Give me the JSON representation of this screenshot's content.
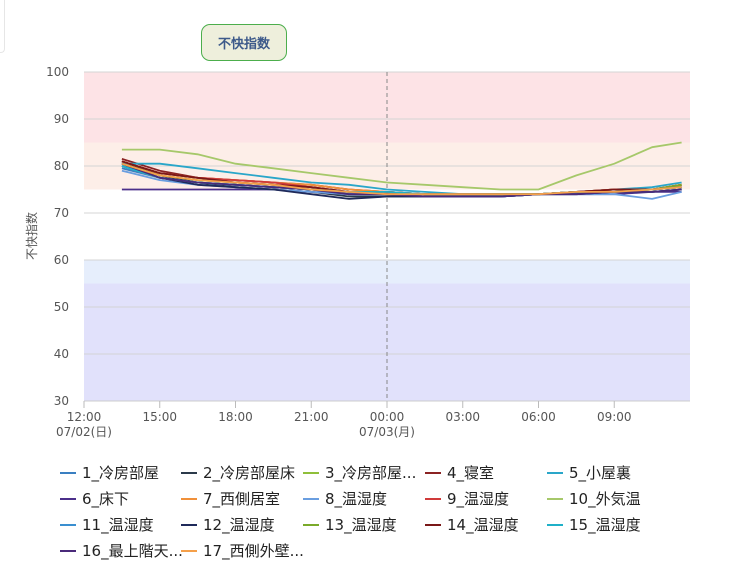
{
  "chart_data": {
    "type": "line",
    "title": "不快指数",
    "ylabel": "不快指数",
    "ylim": [
      30,
      100
    ],
    "yticks": [
      30,
      40,
      50,
      60,
      70,
      80,
      90,
      100
    ],
    "xlim": [
      "2023-07-02 12:00",
      "2023-07-03 12:00"
    ],
    "xticks": [
      {
        "t": "2023-07-02 12:00",
        "l1": "12:00",
        "l2": "07/02(日)"
      },
      {
        "t": "2023-07-02 15:00",
        "l1": "15:00",
        "l2": ""
      },
      {
        "t": "2023-07-02 18:00",
        "l1": "18:00",
        "l2": ""
      },
      {
        "t": "2023-07-02 21:00",
        "l1": "21:00",
        "l2": ""
      },
      {
        "t": "2023-07-03 00:00",
        "l1": "00:00",
        "l2": "07/03(月)"
      },
      {
        "t": "2023-07-03 03:00",
        "l1": "03:00",
        "l2": ""
      },
      {
        "t": "2023-07-03 06:00",
        "l1": "06:00",
        "l2": ""
      },
      {
        "t": "2023-07-03 09:00",
        "l1": "09:00",
        "l2": ""
      }
    ],
    "bands": [
      {
        "from": 85,
        "to": 100,
        "color": "#fde3e6"
      },
      {
        "from": 75,
        "to": 85,
        "color": "#fdeee8"
      },
      {
        "from": 55,
        "to": 60,
        "color": "#e6eefc"
      },
      {
        "from": 30,
        "to": 55,
        "color": "#e1e1fb"
      }
    ],
    "day_divider": "2023-07-03 00:00",
    "x": [
      "2023-07-02 13:30",
      "2023-07-02 15:00",
      "2023-07-02 16:30",
      "2023-07-02 18:00",
      "2023-07-02 19:30",
      "2023-07-02 21:00",
      "2023-07-02 22:30",
      "2023-07-03 00:00",
      "2023-07-03 01:30",
      "2023-07-03 03:00",
      "2023-07-03 04:30",
      "2023-07-03 06:00",
      "2023-07-03 07:30",
      "2023-07-03 09:00",
      "2023-07-03 10:30",
      "2023-07-03 11:40"
    ],
    "series": [
      {
        "name": "1_冷房部屋",
        "color": "#3a7fc1",
        "values": [
          79.5,
          77.5,
          76.5,
          76,
          75.5,
          75,
          74,
          74,
          73.5,
          73.5,
          73.5,
          74,
          74.5,
          74.5,
          74.5,
          75
        ]
      },
      {
        "name": "2_冷房部屋床",
        "color": "#2b3a4a",
        "values": [
          81,
          78,
          76.5,
          75.5,
          75,
          74.5,
          73.5,
          73.5,
          73.5,
          73.5,
          73.5,
          74,
          74.5,
          74.5,
          75,
          75.5
        ]
      },
      {
        "name": "3_冷房部屋...",
        "color": "#8fbf3a",
        "values": [
          80,
          77.5,
          76.5,
          76,
          75.5,
          75,
          74.5,
          74.5,
          74,
          74,
          74,
          74,
          74.5,
          75,
          75,
          76
        ]
      },
      {
        "name": "4_寝室",
        "color": "#8b2323",
        "values": [
          81.5,
          79,
          77.5,
          77,
          76.5,
          76,
          75,
          74.5,
          74,
          74,
          74,
          74,
          74.5,
          75,
          75,
          76
        ]
      },
      {
        "name": "5_小屋裏",
        "color": "#2aa6c9",
        "values": [
          80.5,
          80.5,
          79.5,
          78.5,
          77.5,
          76.5,
          76,
          75,
          74.5,
          74,
          74,
          74,
          74.5,
          75,
          75.5,
          76.5
        ]
      },
      {
        "name": "6_床下",
        "color": "#4b2f8a",
        "values": [
          75,
          75,
          75,
          75,
          75,
          74.5,
          74,
          74,
          73.5,
          73.5,
          73.5,
          74,
          74,
          74,
          74.5,
          74.5
        ]
      },
      {
        "name": "7_西側居室",
        "color": "#f0903a",
        "values": [
          81,
          78.5,
          77.5,
          77,
          76.5,
          76,
          75,
          74.5,
          74,
          74,
          74,
          74,
          74.5,
          75,
          75,
          76
        ]
      },
      {
        "name": "8_温湿度",
        "color": "#6a9ee0",
        "values": [
          79,
          77,
          76,
          75.5,
          75,
          74.5,
          74,
          74,
          73.5,
          73.5,
          73.5,
          74,
          74,
          74,
          73,
          74.5
        ]
      },
      {
        "name": "9_温湿度",
        "color": "#d03a3a",
        "values": [
          81,
          78.5,
          77.5,
          77,
          76.5,
          75.5,
          74.5,
          74.5,
          74,
          74,
          74,
          74,
          74.5,
          75,
          75,
          76
        ]
      },
      {
        "name": "10_外気温",
        "color": "#a6c86a",
        "values": [
          83.5,
          83.5,
          82.5,
          80.5,
          79.5,
          78.5,
          77.5,
          76.5,
          76,
          75.5,
          75,
          75,
          78,
          80.5,
          84,
          85
        ]
      },
      {
        "name": "11_温湿度",
        "color": "#3a8fd0",
        "values": [
          80,
          77.5,
          76.5,
          76,
          75.5,
          75,
          74,
          74,
          73.5,
          73.5,
          73.5,
          74,
          74.5,
          74.5,
          74.5,
          75
        ]
      },
      {
        "name": "12_温湿度",
        "color": "#1f2a5a",
        "values": [
          80.5,
          77.5,
          76,
          75.5,
          75,
          74,
          73,
          73.5,
          73.5,
          73.5,
          73.5,
          74,
          74,
          74.5,
          74.5,
          75
        ]
      },
      {
        "name": "13_温湿度",
        "color": "#7aaa2a",
        "values": [
          80.5,
          78,
          77,
          76.5,
          76,
          75,
          74.5,
          74,
          74,
          74,
          74,
          74,
          74.5,
          74.5,
          75,
          76
        ]
      },
      {
        "name": "14_温湿度",
        "color": "#7a1818",
        "values": [
          81,
          78.5,
          77.5,
          76.5,
          76,
          75.5,
          74.5,
          74,
          74,
          74,
          74,
          74,
          74.5,
          75,
          75,
          75.5
        ]
      },
      {
        "name": "15_温湿度",
        "color": "#1fb0c8",
        "values": [
          80,
          77.5,
          76.5,
          76,
          75.5,
          75,
          74.5,
          74.5,
          74,
          74,
          74,
          74,
          74.5,
          74.5,
          75,
          75.5
        ]
      },
      {
        "name": "16_最上階天...",
        "color": "#4a2a7a",
        "values": [
          80.5,
          77.5,
          76.5,
          76,
          75.5,
          75,
          74,
          74,
          73.5,
          73.5,
          73.5,
          74,
          74,
          74.5,
          74.5,
          75
        ]
      },
      {
        "name": "17_西側外壁...",
        "color": "#f5a04a",
        "values": [
          80.5,
          78,
          77,
          76.5,
          76,
          75,
          74.5,
          74,
          74,
          74,
          74,
          74,
          74.5,
          74.5,
          75,
          75.5
        ]
      }
    ]
  }
}
